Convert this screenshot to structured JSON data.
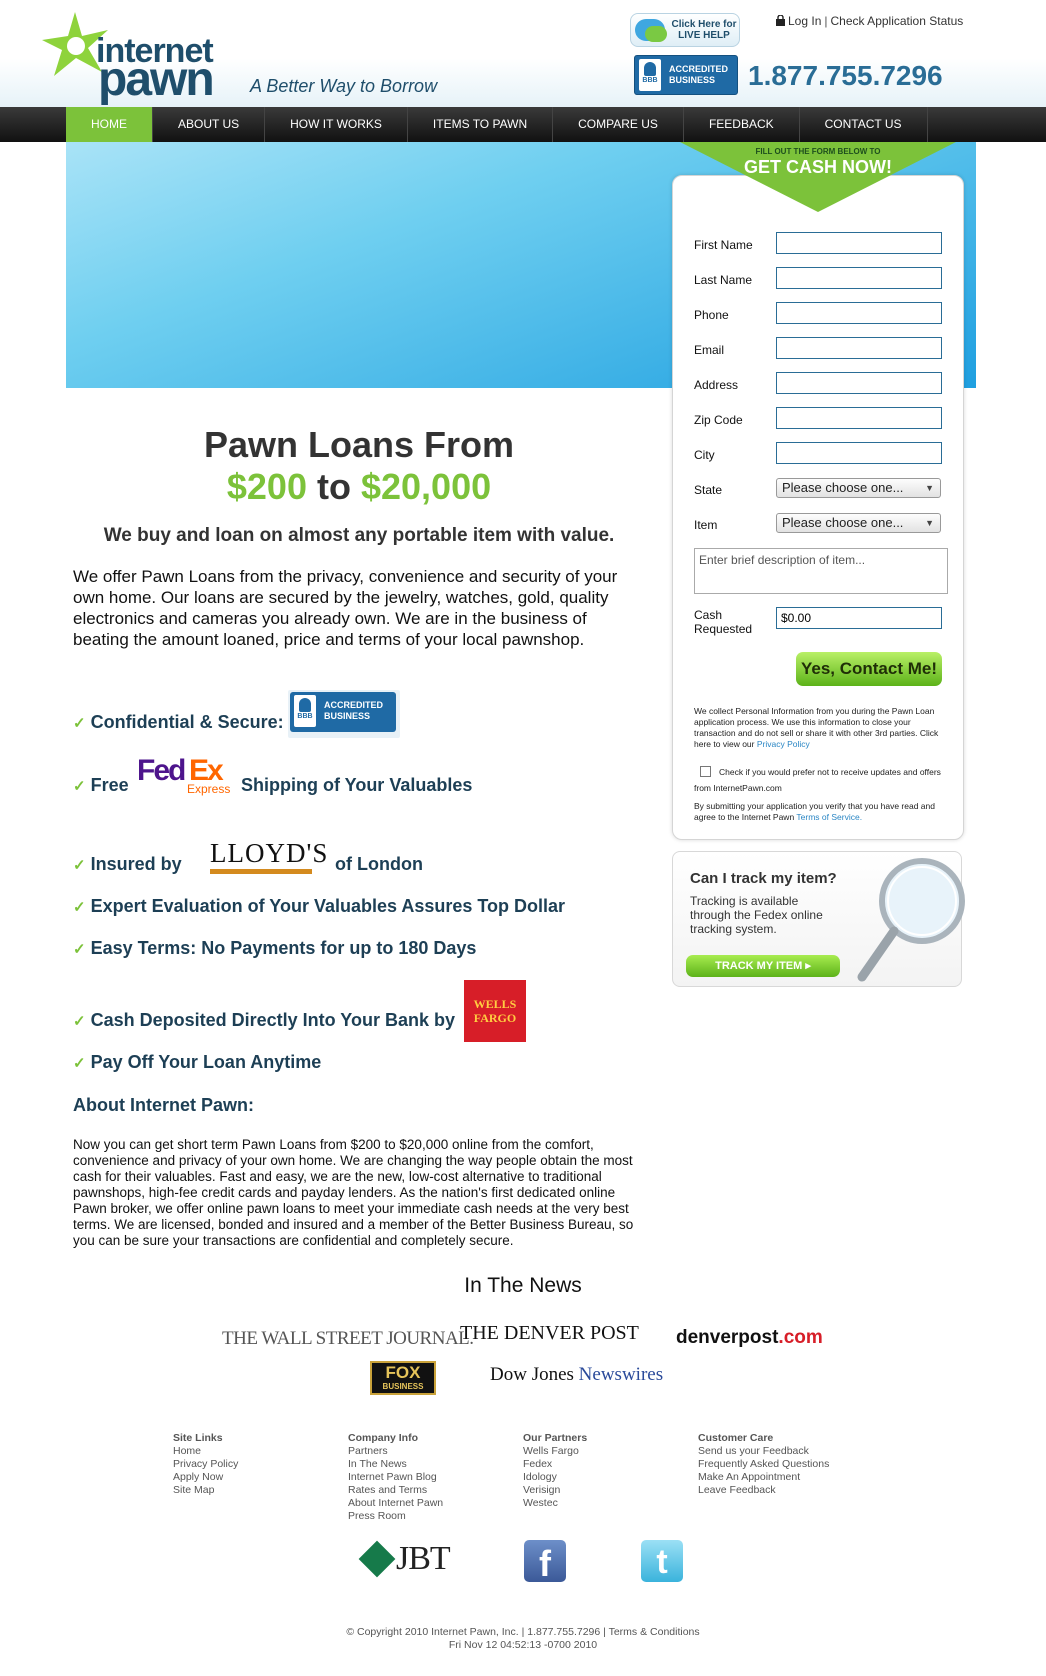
{
  "header": {
    "logo_line1": "internet",
    "logo_line2": "pawn",
    "tagline": "A Better Way to Borrow",
    "live_help": "Click Here for LIVE HELP",
    "login": "Log In",
    "check_status": "Check Application Status",
    "bbb_label": "ACCREDITED BUSINESS",
    "bbb_seal": "BBB",
    "phone": "1.877.755.7296"
  },
  "nav": {
    "items": [
      "HOME",
      "ABOUT US",
      "HOW IT WORKS",
      "ITEMS TO PAWN",
      "COMPARE US",
      "FEEDBACK",
      "CONTACT US"
    ],
    "active_index": 0
  },
  "form": {
    "banner_small": "FILL OUT THE FORM BELOW TO",
    "banner_big": "GET CASH NOW!",
    "fields": {
      "first_name": "First Name",
      "last_name": "Last Name",
      "phone": "Phone",
      "email": "Email",
      "address": "Address",
      "zip": "Zip Code",
      "city": "City",
      "state": "State",
      "item": "Item",
      "cash": "Cash Requested"
    },
    "state_value": "Please choose one...",
    "item_value": "Please choose one...",
    "description_placeholder": "Enter brief description of item...",
    "cash_value": "$0.00",
    "submit": "Yes, Contact Me!",
    "privacy_text": "We collect Personal Information from you during the Pawn Loan application process. We use this information to close your transaction and do not sell or share it with other 3rd parties. Click here to view our",
    "privacy_link": "Privacy Policy",
    "optout_text": "Check if you would prefer not to receive updates and offers from InternetPawn.com",
    "terms_text": "By submitting your application you verify that you have read and agree to the Internet Pawn",
    "terms_link": "Terms of Service."
  },
  "track": {
    "title": "Can I track my item?",
    "text": "Tracking is available through the Fedex online tracking system.",
    "button": "TRACK MY ITEM ▸"
  },
  "main": {
    "headline_line1": "Pawn Loans From",
    "amount_min": "$200",
    "amount_to": "to",
    "amount_max": "$20,000",
    "subhead": "We buy and loan on almost any portable item with value.",
    "intro": "We offer Pawn Loans from the privacy, convenience and security of your own home. Our loans are secured by the jewelry, watches, gold, quality electronics and cameras you already own. We are in the business of beating the amount loaned, price and terms of your local pawnshop.",
    "features": {
      "f1": "Confidential & Secure:",
      "f2a": "Free",
      "f2b": "Shipping of Your Valuables",
      "f3a": "Insured by",
      "f3b": "of London",
      "f4": "Expert Evaluation of Your Valuables Assures Top Dollar",
      "f5": "Easy Terms: No Payments for up to 180 Days",
      "f6": "Cash Deposited Directly Into Your Bank by",
      "f7": "Pay Off Your Loan Anytime"
    },
    "fedex_fed": "Fed",
    "fedex_ex": "Ex",
    "fedex_express": "Express",
    "lloyds": "LLOYD'S",
    "wells_fargo": "WELLS FARGO",
    "about_title": "About Internet Pawn:",
    "about_text": "Now you can get short term Pawn Loans from $200 to $20,000 online from the comfort, convenience and privacy of your own home. We are changing the way people obtain the most cash for their valuables. Fast and easy, we are the new, low-cost alternative to traditional pawnshops, high-fee credit cards and payday lenders. As the nation's first dedicated online Pawn broker, we offer online pawn loans to meet your immediate cash needs at the very best terms. We are licensed, bonded and insured and a member of the Better Business Bureau, so you can be sure your transactions are confidential and completely secure."
  },
  "news": {
    "title": "In The News",
    "wsj": "THE WALL STREET JOURNAL.",
    "denver_post": "THE DENVER POST",
    "denverpost_com_a": "denverpost",
    "denverpost_com_b": ".com",
    "fox": "FOX",
    "fox_small": "BUSINESS",
    "dowjones_a": "Dow Jones",
    "dowjones_b": "Newswires"
  },
  "footer": {
    "site_links": {
      "title": "Site Links",
      "items": [
        "Home",
        "Privacy Policy",
        "Apply Now",
        "Site Map"
      ]
    },
    "company_info": {
      "title": "Company Info",
      "items": [
        "Partners",
        "In The News",
        "Internet Pawn Blog",
        "Rates and Terms",
        "About Internet Pawn",
        "Press Room"
      ]
    },
    "partners": {
      "title": "Our Partners",
      "items": [
        "Wells Fargo",
        "Fedex",
        "Idology",
        "Verisign",
        "Westec"
      ]
    },
    "customer_care": {
      "title": "Customer Care",
      "items": [
        "Send us your Feedback",
        "Frequently Asked Questions",
        "Make An Appointment",
        "Leave Feedback"
      ]
    },
    "jbt": "JBT",
    "facebook": "f",
    "twitter": "t",
    "copyright": "© Copyright 2010 Internet Pawn, Inc. | 1.877.755.7296 | Terms & Conditions",
    "timestamp": "Fri Nov 12 04:52:13 -0700 2010"
  },
  "colors": {
    "accent_green": "#7cc23a",
    "brand_blue": "#1f4e6b",
    "phone_blue": "#2a6d96"
  }
}
